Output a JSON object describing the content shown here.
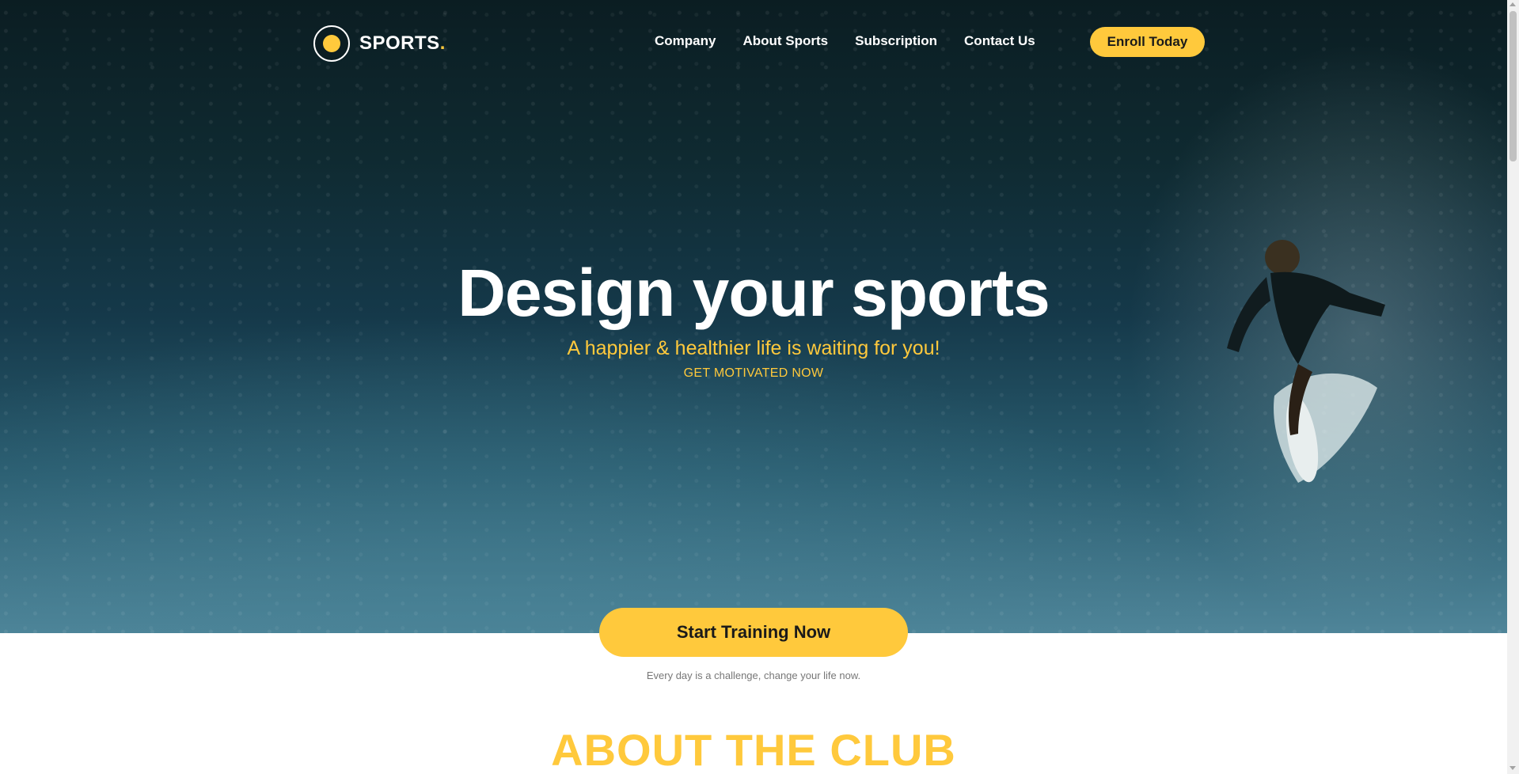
{
  "brand": {
    "name": "SPORTS",
    "dot": ".",
    "accent_color": "#ffc93c",
    "logo_icon": "club-badge-icon"
  },
  "nav": {
    "items": [
      {
        "label": "Company"
      },
      {
        "label": "About Sports"
      },
      {
        "label": "Subscription"
      },
      {
        "label": "Contact Us"
      }
    ],
    "enroll_label": "Enroll Today"
  },
  "hero": {
    "title": "Design your sports",
    "subtitle": "A happier & healthier life is waiting for you!",
    "cta_text": "GET MOTIVATED NOW",
    "background": "surfer-in-wave-image"
  },
  "cta": {
    "button_label": "Start Training Now",
    "tagline": "Every day is a challenge, change your life now."
  },
  "about": {
    "title": "ABOUT THE CLUB"
  }
}
